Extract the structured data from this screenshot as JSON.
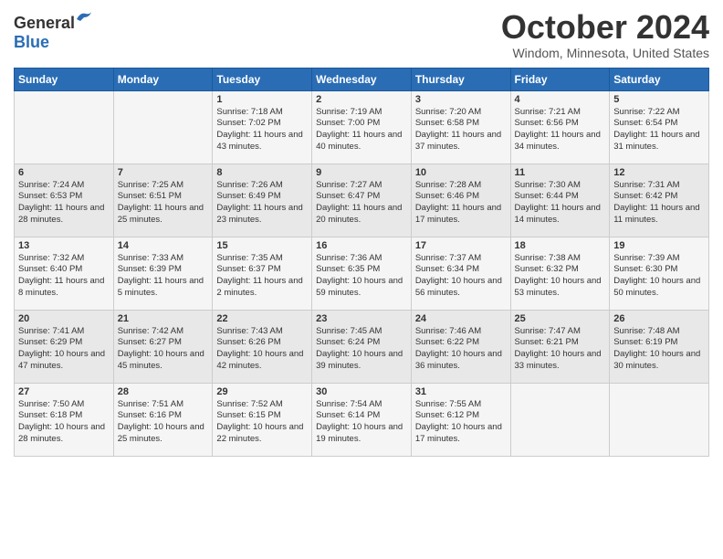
{
  "header": {
    "logo_general": "General",
    "logo_blue": "Blue",
    "month_title": "October 2024",
    "location": "Windom, Minnesota, United States"
  },
  "days_of_week": [
    "Sunday",
    "Monday",
    "Tuesday",
    "Wednesday",
    "Thursday",
    "Friday",
    "Saturday"
  ],
  "weeks": [
    [
      {
        "day": "",
        "content": ""
      },
      {
        "day": "",
        "content": ""
      },
      {
        "day": "1",
        "content": "Sunrise: 7:18 AM\nSunset: 7:02 PM\nDaylight: 11 hours and 43 minutes."
      },
      {
        "day": "2",
        "content": "Sunrise: 7:19 AM\nSunset: 7:00 PM\nDaylight: 11 hours and 40 minutes."
      },
      {
        "day": "3",
        "content": "Sunrise: 7:20 AM\nSunset: 6:58 PM\nDaylight: 11 hours and 37 minutes."
      },
      {
        "day": "4",
        "content": "Sunrise: 7:21 AM\nSunset: 6:56 PM\nDaylight: 11 hours and 34 minutes."
      },
      {
        "day": "5",
        "content": "Sunrise: 7:22 AM\nSunset: 6:54 PM\nDaylight: 11 hours and 31 minutes."
      }
    ],
    [
      {
        "day": "6",
        "content": "Sunrise: 7:24 AM\nSunset: 6:53 PM\nDaylight: 11 hours and 28 minutes."
      },
      {
        "day": "7",
        "content": "Sunrise: 7:25 AM\nSunset: 6:51 PM\nDaylight: 11 hours and 25 minutes."
      },
      {
        "day": "8",
        "content": "Sunrise: 7:26 AM\nSunset: 6:49 PM\nDaylight: 11 hours and 23 minutes."
      },
      {
        "day": "9",
        "content": "Sunrise: 7:27 AM\nSunset: 6:47 PM\nDaylight: 11 hours and 20 minutes."
      },
      {
        "day": "10",
        "content": "Sunrise: 7:28 AM\nSunset: 6:46 PM\nDaylight: 11 hours and 17 minutes."
      },
      {
        "day": "11",
        "content": "Sunrise: 7:30 AM\nSunset: 6:44 PM\nDaylight: 11 hours and 14 minutes."
      },
      {
        "day": "12",
        "content": "Sunrise: 7:31 AM\nSunset: 6:42 PM\nDaylight: 11 hours and 11 minutes."
      }
    ],
    [
      {
        "day": "13",
        "content": "Sunrise: 7:32 AM\nSunset: 6:40 PM\nDaylight: 11 hours and 8 minutes."
      },
      {
        "day": "14",
        "content": "Sunrise: 7:33 AM\nSunset: 6:39 PM\nDaylight: 11 hours and 5 minutes."
      },
      {
        "day": "15",
        "content": "Sunrise: 7:35 AM\nSunset: 6:37 PM\nDaylight: 11 hours and 2 minutes."
      },
      {
        "day": "16",
        "content": "Sunrise: 7:36 AM\nSunset: 6:35 PM\nDaylight: 10 hours and 59 minutes."
      },
      {
        "day": "17",
        "content": "Sunrise: 7:37 AM\nSunset: 6:34 PM\nDaylight: 10 hours and 56 minutes."
      },
      {
        "day": "18",
        "content": "Sunrise: 7:38 AM\nSunset: 6:32 PM\nDaylight: 10 hours and 53 minutes."
      },
      {
        "day": "19",
        "content": "Sunrise: 7:39 AM\nSunset: 6:30 PM\nDaylight: 10 hours and 50 minutes."
      }
    ],
    [
      {
        "day": "20",
        "content": "Sunrise: 7:41 AM\nSunset: 6:29 PM\nDaylight: 10 hours and 47 minutes."
      },
      {
        "day": "21",
        "content": "Sunrise: 7:42 AM\nSunset: 6:27 PM\nDaylight: 10 hours and 45 minutes."
      },
      {
        "day": "22",
        "content": "Sunrise: 7:43 AM\nSunset: 6:26 PM\nDaylight: 10 hours and 42 minutes."
      },
      {
        "day": "23",
        "content": "Sunrise: 7:45 AM\nSunset: 6:24 PM\nDaylight: 10 hours and 39 minutes."
      },
      {
        "day": "24",
        "content": "Sunrise: 7:46 AM\nSunset: 6:22 PM\nDaylight: 10 hours and 36 minutes."
      },
      {
        "day": "25",
        "content": "Sunrise: 7:47 AM\nSunset: 6:21 PM\nDaylight: 10 hours and 33 minutes."
      },
      {
        "day": "26",
        "content": "Sunrise: 7:48 AM\nSunset: 6:19 PM\nDaylight: 10 hours and 30 minutes."
      }
    ],
    [
      {
        "day": "27",
        "content": "Sunrise: 7:50 AM\nSunset: 6:18 PM\nDaylight: 10 hours and 28 minutes."
      },
      {
        "day": "28",
        "content": "Sunrise: 7:51 AM\nSunset: 6:16 PM\nDaylight: 10 hours and 25 minutes."
      },
      {
        "day": "29",
        "content": "Sunrise: 7:52 AM\nSunset: 6:15 PM\nDaylight: 10 hours and 22 minutes."
      },
      {
        "day": "30",
        "content": "Sunrise: 7:54 AM\nSunset: 6:14 PM\nDaylight: 10 hours and 19 minutes."
      },
      {
        "day": "31",
        "content": "Sunrise: 7:55 AM\nSunset: 6:12 PM\nDaylight: 10 hours and 17 minutes."
      },
      {
        "day": "",
        "content": ""
      },
      {
        "day": "",
        "content": ""
      }
    ]
  ]
}
